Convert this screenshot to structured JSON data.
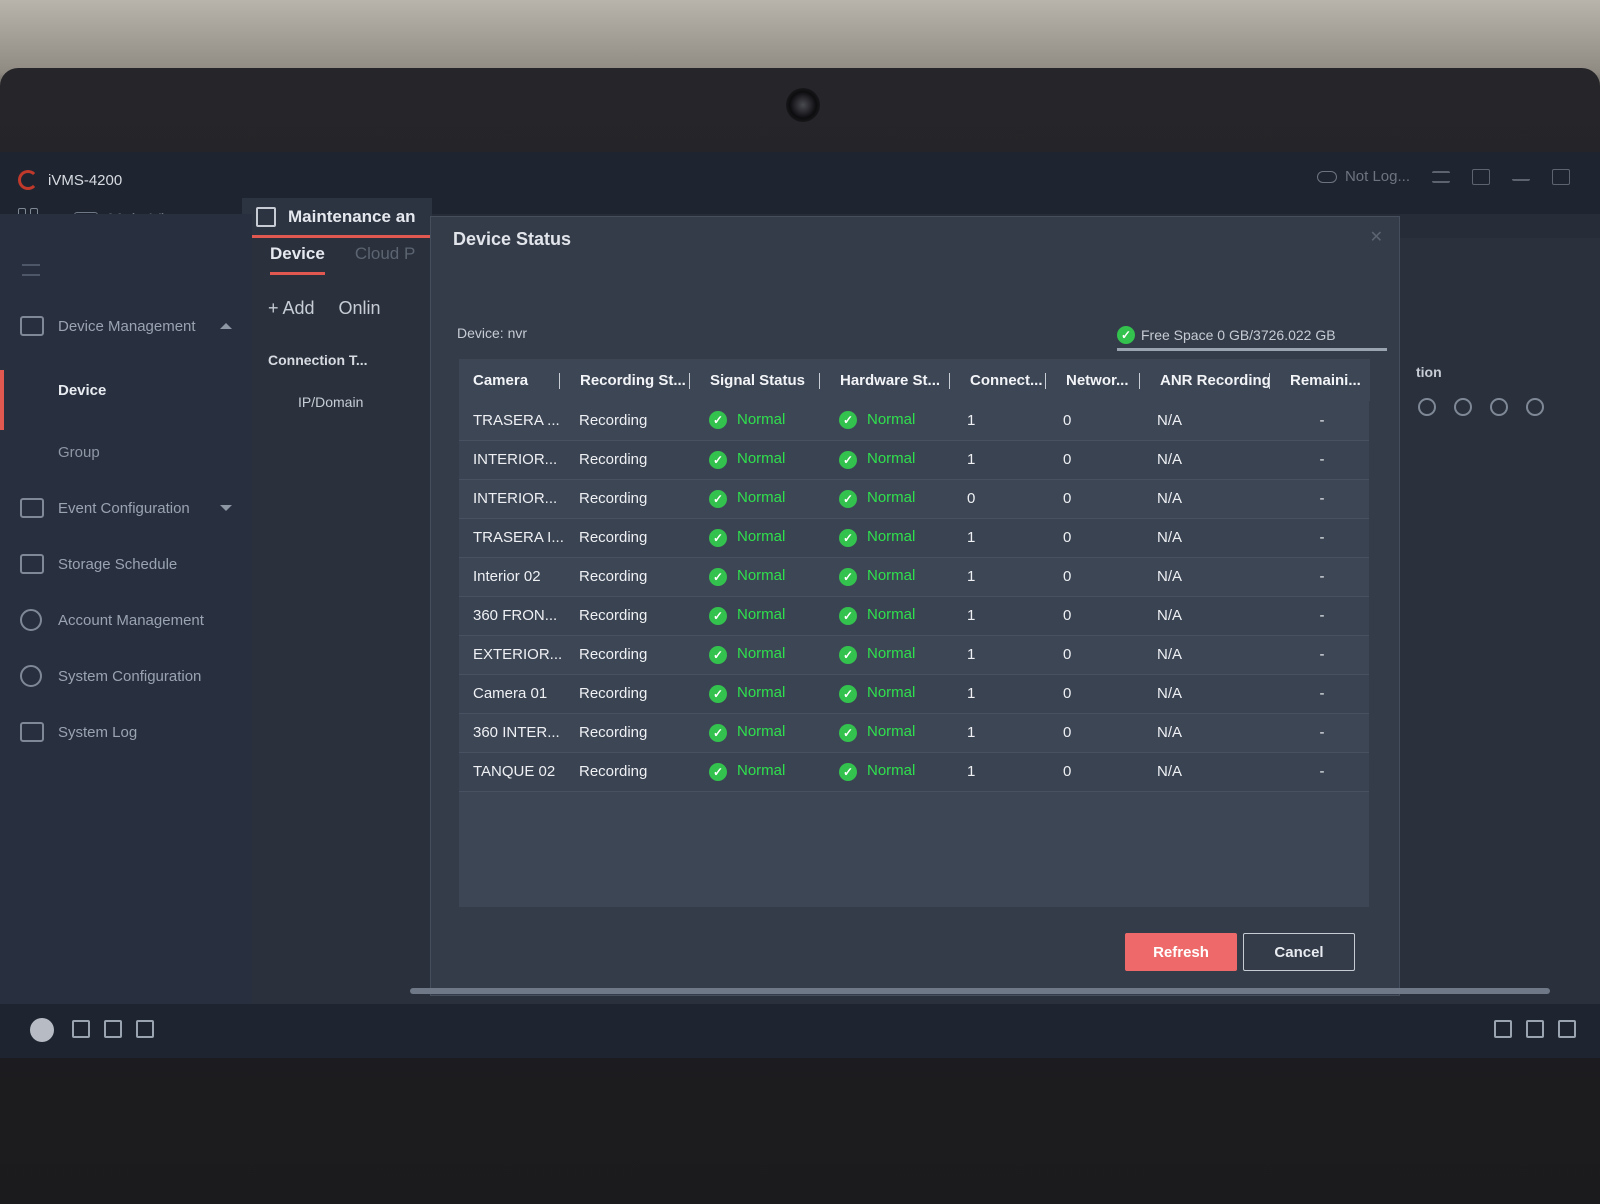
{
  "window": {
    "app_title": "iVMS-4200",
    "main_view_label": "Main View",
    "maintenance_tab_label": "Maintenance an",
    "login_status": "Not Log..."
  },
  "sidebar": {
    "items": [
      {
        "label": "Device Management",
        "icon": "device-management-icon"
      },
      {
        "label": "Device"
      },
      {
        "label": "Group"
      },
      {
        "label": "Event Configuration",
        "icon": "event-icon"
      },
      {
        "label": "Storage Schedule",
        "icon": "storage-icon"
      },
      {
        "label": "Account Management",
        "icon": "user-icon"
      },
      {
        "label": "System Configuration",
        "icon": "gear-icon"
      },
      {
        "label": "System Log",
        "icon": "log-icon"
      }
    ]
  },
  "content": {
    "tabs": [
      "Device",
      "Cloud P"
    ],
    "toolbar": {
      "add_label": "+ Add",
      "online_label": "Onlin"
    },
    "list_header": "Connection T...",
    "list_row": "IP/Domain",
    "right_fragment": "tion"
  },
  "dialog": {
    "title": "Device Status",
    "device_line": "Device: nvr",
    "free_space": "Free Space 0 GB/3726.022 GB",
    "columns": [
      "Camera",
      "Recording St...",
      "Signal Status",
      "Hardware St...",
      "Connect...",
      "Networ...",
      "ANR Recording",
      "Remaini..."
    ],
    "rows": [
      {
        "camera": "TRASERA ...",
        "recording": "Recording",
        "signal": "Normal",
        "hardware": "Normal",
        "connect": "1",
        "network": "0",
        "anr": "N/A",
        "remaining": "-"
      },
      {
        "camera": "INTERIOR...",
        "recording": "Recording",
        "signal": "Normal",
        "hardware": "Normal",
        "connect": "1",
        "network": "0",
        "anr": "N/A",
        "remaining": "-"
      },
      {
        "camera": "INTERIOR...",
        "recording": "Recording",
        "signal": "Normal",
        "hardware": "Normal",
        "connect": "0",
        "network": "0",
        "anr": "N/A",
        "remaining": "-"
      },
      {
        "camera": "TRASERA I...",
        "recording": "Recording",
        "signal": "Normal",
        "hardware": "Normal",
        "connect": "1",
        "network": "0",
        "anr": "N/A",
        "remaining": "-"
      },
      {
        "camera": "Interior 02",
        "recording": "Recording",
        "signal": "Normal",
        "hardware": "Normal",
        "connect": "1",
        "network": "0",
        "anr": "N/A",
        "remaining": "-"
      },
      {
        "camera": "360 FRON...",
        "recording": "Recording",
        "signal": "Normal",
        "hardware": "Normal",
        "connect": "1",
        "network": "0",
        "anr": "N/A",
        "remaining": "-"
      },
      {
        "camera": "EXTERIOR...",
        "recording": "Recording",
        "signal": "Normal",
        "hardware": "Normal",
        "connect": "1",
        "network": "0",
        "anr": "N/A",
        "remaining": "-"
      },
      {
        "camera": "Camera 01",
        "recording": "Recording",
        "signal": "Normal",
        "hardware": "Normal",
        "connect": "1",
        "network": "0",
        "anr": "N/A",
        "remaining": "-"
      },
      {
        "camera": "360 INTER...",
        "recording": "Recording",
        "signal": "Normal",
        "hardware": "Normal",
        "connect": "1",
        "network": "0",
        "anr": "N/A",
        "remaining": "-"
      },
      {
        "camera": "TANQUE 02",
        "recording": "Recording",
        "signal": "Normal",
        "hardware": "Normal",
        "connect": "1",
        "network": "0",
        "anr": "N/A",
        "remaining": "-"
      }
    ],
    "refresh_label": "Refresh",
    "cancel_label": "Cancel"
  },
  "colors": {
    "accent": "#e0584f",
    "status_ok": "#2fe04d",
    "refresh_button": "#ee6a6a"
  }
}
